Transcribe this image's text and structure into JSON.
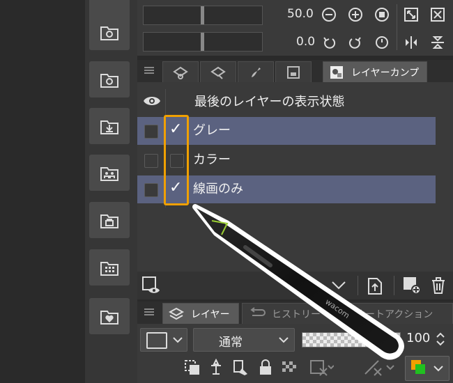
{
  "navigator": {
    "zoom_value": "50.0",
    "rotation_value": "0.0"
  },
  "tabs_top": {
    "active_label": "レイヤーカンプ"
  },
  "layer_comp": {
    "header_label": "最後のレイヤーの表示状態",
    "rows": [
      {
        "label": "グレー",
        "checked": true,
        "selected": true
      },
      {
        "label": "カラー",
        "checked": false,
        "selected": false
      },
      {
        "label": "線画のみ",
        "checked": true,
        "selected": true
      }
    ]
  },
  "tabs_bottom": {
    "layer_label": "レイヤー",
    "history_label": "ヒストリー",
    "auto_action_label": "オートアクション"
  },
  "layer_panel": {
    "blend_mode": "通常",
    "opacity": "100"
  },
  "pen": {
    "brand": "wacom"
  },
  "colors": {
    "highlight_border": "#f0a000",
    "selected_row": "#5b6280",
    "panel_bg": "#3a3a3a"
  }
}
